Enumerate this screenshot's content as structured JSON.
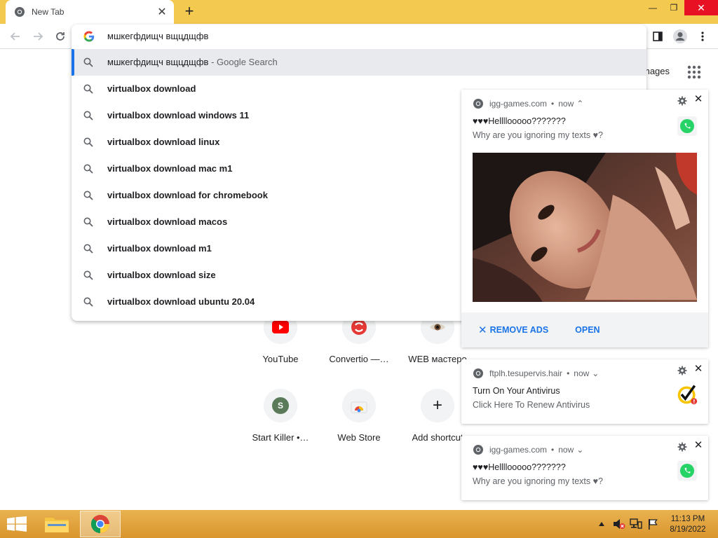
{
  "browser": {
    "tab_title": "New Tab",
    "new_tab_symbol": "+",
    "close_tab_symbol": "✕",
    "window_min": "—",
    "window_max": "❐",
    "window_close": "✕"
  },
  "omnibox": {
    "input_text": "мшкегфдищч вщцдщфв",
    "suggestions": [
      {
        "text": "мшкегфдищч вщцдщфв",
        "suffix": " - Google Search",
        "selected": true
      },
      {
        "text": "virtualbox download"
      },
      {
        "text": "virtualbox download windows 11"
      },
      {
        "text": "virtualbox download linux"
      },
      {
        "text": "virtualbox download mac m1"
      },
      {
        "text": "virtualbox download for chromebook"
      },
      {
        "text": "virtualbox download macos"
      },
      {
        "text": "virtualbox download m1"
      },
      {
        "text": "virtualbox download size"
      },
      {
        "text": "virtualbox download ubuntu 20.04"
      }
    ]
  },
  "ntp": {
    "images_link": "mages",
    "shortcuts": [
      {
        "label": "YouTube",
        "icon": "youtube-icon"
      },
      {
        "label": "Convertio —…",
        "icon": "convertio-icon"
      },
      {
        "label": "WEB мастеро",
        "icon": "eye-icon"
      },
      {
        "label": "Start Killer •…",
        "icon": "letter-s-icon",
        "letter": "S"
      },
      {
        "label": "Web Store",
        "icon": "web-store-icon"
      },
      {
        "label": "Add shortcut",
        "icon": "plus-icon",
        "symbol": "+"
      }
    ]
  },
  "notifications": [
    {
      "source": "igg-games.com",
      "time": "now",
      "chevron": "⌃",
      "title": "♥♥♥Hellllooooo???????",
      "body": "Why are you ignoring my texts ♥?",
      "thumb": "whatsapp-icon",
      "has_image": true,
      "actions": {
        "remove_ads": "REMOVE ADS",
        "open": "OPEN",
        "remove_symbol": "✕"
      }
    },
    {
      "source": "ftplh.tesupervis.hair",
      "time": "now",
      "chevron": "⌄",
      "title": "Turn On Your Antivirus",
      "body": "Click Here To Renew Antivirus",
      "thumb": "antivirus-check-icon"
    },
    {
      "source": "igg-games.com",
      "time": "now",
      "chevron": "⌄",
      "title": "♥♥♥Hellllooooo???????",
      "body": "Why are you ignoring my texts ♥?",
      "thumb": "whatsapp-icon"
    }
  ],
  "notif_bullet": "•",
  "notif_close": "✕",
  "taskbar": {
    "time": "11:13 PM",
    "date": "8/19/2022"
  },
  "colors": {
    "titlebar": "#f3c94f",
    "accent": "#1a73e8",
    "taskbar": "#e0a33d",
    "close_red": "#e81123"
  }
}
